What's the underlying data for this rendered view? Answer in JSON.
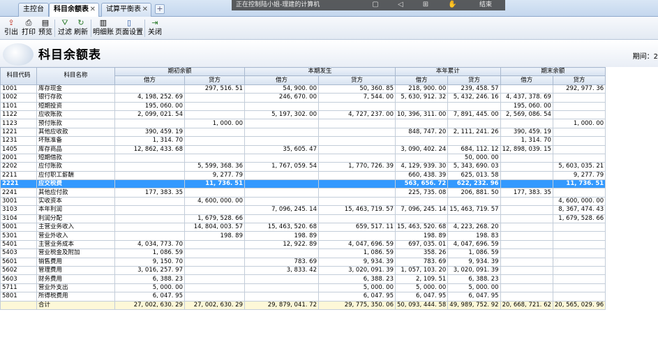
{
  "tabs": [
    {
      "label": "主控台",
      "active": false
    },
    {
      "label": "科目余额表",
      "active": true
    },
    {
      "label": "试算平衡表",
      "active": false
    }
  ],
  "overlay": {
    "status": "正在控制陆小姐-理建的计算机",
    "end_label": "结束"
  },
  "toolbar": [
    {
      "id": "export",
      "label": "引出",
      "icon": "export-icon"
    },
    {
      "id": "print",
      "label": "打印",
      "icon": "printer-icon"
    },
    {
      "id": "preview",
      "label": "预览",
      "icon": "preview-icon"
    },
    {
      "id": "filter",
      "label": "过滤",
      "icon": "filter-icon"
    },
    {
      "id": "refresh",
      "label": "刷新",
      "icon": "refresh-icon"
    },
    {
      "id": "detail",
      "label": "明细账",
      "icon": "ledger-icon"
    },
    {
      "id": "pagesetup",
      "label": "页面设置",
      "icon": "book-icon"
    },
    {
      "id": "close",
      "label": "关闭",
      "icon": "exit-icon"
    }
  ],
  "page_title": "科目余额表",
  "period_label": "期间：2",
  "table": {
    "col_code": "科目代码",
    "col_name": "科目名称",
    "groups": [
      "期初余额",
      "本期发生",
      "本年累计",
      "期末余额"
    ],
    "sub": [
      "借方",
      "贷方"
    ],
    "rows": [
      [
        "1001",
        "库存现金",
        "",
        "297, 516. 51",
        "54, 900. 00",
        "50, 360. 85",
        "218, 900. 00",
        "239, 458. 57",
        "",
        "292, 977. 36"
      ],
      [
        "1002",
        "银行存款",
        "4, 198, 252. 69",
        "",
        "246, 670. 00",
        "7, 544. 00",
        "5, 630, 912. 32",
        "5, 432, 246. 16",
        "4, 437, 378. 69",
        ""
      ],
      [
        "1101",
        "短期投资",
        "195, 060. 00",
        "",
        "",
        "",
        "",
        "",
        "195, 060. 00",
        ""
      ],
      [
        "1122",
        "应收账款",
        "2, 099, 021. 54",
        "",
        "5, 197, 302. 00",
        "4, 727, 237. 00",
        "10, 396, 311. 00",
        "7, 891, 445. 00",
        "2, 569, 086. 54",
        ""
      ],
      [
        "1123",
        "预付账款",
        "",
        "1, 000. 00",
        "",
        "",
        "",
        "",
        "",
        "1, 000. 00"
      ],
      [
        "1221",
        "其他应收款",
        "390, 459. 19",
        "",
        "",
        "",
        "848, 747. 20",
        "2, 111, 241. 26",
        "390, 459. 19",
        ""
      ],
      [
        "1231",
        "坏账准备",
        "1, 314. 70",
        "",
        "",
        "",
        "",
        "",
        "1, 314. 70",
        ""
      ],
      [
        "1405",
        "库存商品",
        "12, 862, 433. 68",
        "",
        "35, 605. 47",
        "",
        "3, 090, 402. 24",
        "684, 112. 12",
        "12, 898, 039. 15",
        ""
      ],
      [
        "2001",
        "短期借款",
        "",
        "",
        "",
        "",
        "",
        "50, 000. 00",
        "",
        ""
      ],
      [
        "2202",
        "应付账款",
        "",
        "5, 599, 368. 36",
        "1, 767, 059. 54",
        "1, 770, 726. 39",
        "4, 129, 939. 30",
        "5, 343, 690. 03",
        "",
        "5, 603, 035. 21"
      ],
      [
        "2211",
        "应付职工薪酬",
        "",
        "9, 277. 79",
        "",
        "",
        "660, 438. 39",
        "625, 013. 58",
        "",
        "9, 277. 79"
      ],
      [
        "2221",
        "应交税费",
        "",
        "11, 736. 51",
        "",
        "",
        "563, 656. 72",
        "622, 232. 96",
        "",
        "11, 736. 51"
      ],
      [
        "2241",
        "其他应付款",
        "177, 383. 35",
        "",
        "",
        "",
        "225, 735. 08",
        "206, 881. 50",
        "177, 383. 35",
        ""
      ],
      [
        "3001",
        "实收资本",
        "",
        "4, 600, 000. 00",
        "",
        "",
        "",
        "",
        "",
        "4, 600, 000. 00"
      ],
      [
        "3103",
        "本年利润",
        "",
        "",
        "7, 096, 245. 14",
        "15, 463, 719. 57",
        "7, 096, 245. 14",
        "15, 463, 719. 57",
        "",
        "8, 367, 474. 43"
      ],
      [
        "3104",
        "利润分配",
        "",
        "1, 679, 528. 66",
        "",
        "",
        "",
        "",
        "",
        "1, 679, 528. 66"
      ],
      [
        "5001",
        "主营业务收入",
        "",
        "14, 804, 003. 57",
        "15, 463, 520. 68",
        "659, 517. 11",
        "15, 463, 520. 68",
        "4, 223, 268. 20",
        "",
        ""
      ],
      [
        "5301",
        "营业外收入",
        "",
        "198. 89",
        "198. 89",
        "",
        "198. 89",
        "198. 83",
        "",
        ""
      ],
      [
        "5401",
        "主营业务成本",
        "4, 034, 773. 70",
        "",
        "12, 922. 89",
        "4, 047, 696. 59",
        "697, 035. 01",
        "4, 047, 696. 59",
        "",
        ""
      ],
      [
        "5403",
        "营业税金及附加",
        "1, 086. 59",
        "",
        "",
        "1, 086. 59",
        "358. 26",
        "1, 086. 59",
        "",
        ""
      ],
      [
        "5601",
        "销售费用",
        "9, 150. 70",
        "",
        "783. 69",
        "9, 934. 39",
        "783. 69",
        "9, 934. 39",
        "",
        ""
      ],
      [
        "5602",
        "管理费用",
        "3, 016, 257. 97",
        "",
        "3, 833. 42",
        "3, 020, 091. 39",
        "1, 057, 103. 20",
        "3, 020, 091. 39",
        "",
        ""
      ],
      [
        "5603",
        "财务费用",
        "6, 388. 23",
        "",
        "",
        "6, 388. 23",
        "2, 109. 51",
        "6, 388. 23",
        "",
        ""
      ],
      [
        "5711",
        "营业外支出",
        "5, 000. 00",
        "",
        "",
        "5, 000. 00",
        "5, 000. 00",
        "5, 000. 00",
        "",
        ""
      ],
      [
        "5801",
        "所得税费用",
        "6, 047. 95",
        "",
        "",
        "6, 047. 95",
        "6, 047. 95",
        "6, 047. 95",
        "",
        ""
      ],
      [
        "",
        "合计",
        "27, 002, 630. 29",
        "27, 002, 630. 29",
        "29, 879, 041. 72",
        "29, 775, 350. 06",
        "50, 093, 444. 58",
        "49, 989, 752. 92",
        "20, 668, 721. 62",
        "20, 565, 029. 96"
      ]
    ],
    "selected_row": 11,
    "total_row": 25
  },
  "colors": {
    "selected": "#3399ff",
    "total_row": "#fdf8d8",
    "header": "#d7e2f0"
  }
}
